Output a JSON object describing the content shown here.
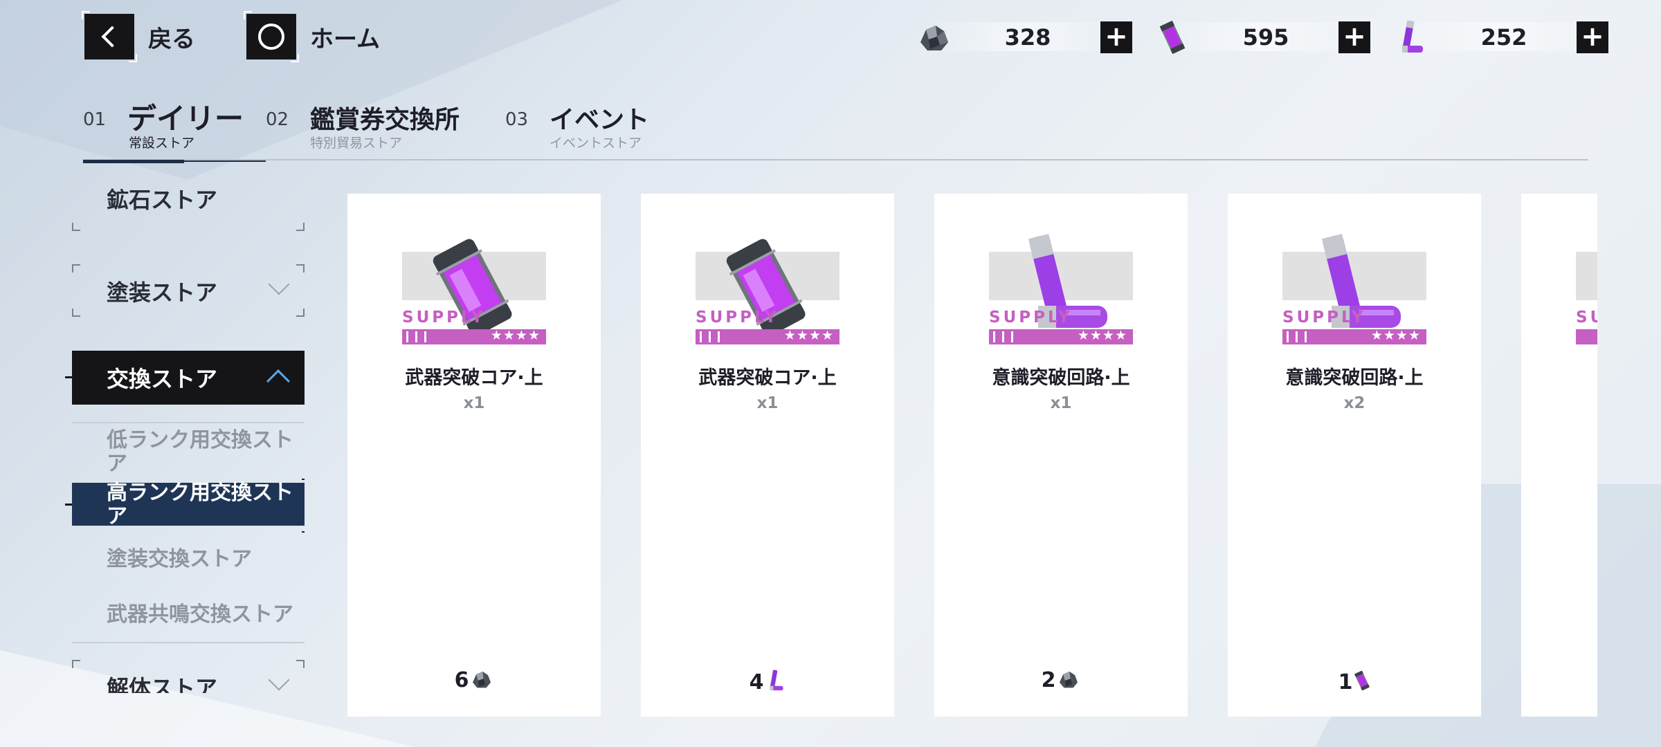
{
  "nav": {
    "back_label": "戻る",
    "home_label": "ホーム"
  },
  "resources": [
    {
      "icon": "ore-icon",
      "value": "328"
    },
    {
      "icon": "weapon-core-icon",
      "value": "595"
    },
    {
      "icon": "circuit-icon",
      "value": "252"
    }
  ],
  "tabs": [
    {
      "num": "01",
      "label": "デイリー",
      "sub": "常設ストア",
      "active": true
    },
    {
      "num": "02",
      "label": "鑑賞券交換所",
      "sub": "特別貿易ストア",
      "active": false
    },
    {
      "num": "03",
      "label": "イベント",
      "sub": "イベントストア",
      "active": false
    }
  ],
  "side": {
    "ore_store": "鉱石ストア",
    "paint_store": "塗装ストア",
    "exchange_store": "交換ストア",
    "sub_items": [
      "低ランク用交換ストア",
      "高ランク用交換ストア",
      "塗装交換ストア",
      "武器共鳴交換ストア"
    ],
    "dismantle_store": "解体ストア"
  },
  "cards": [
    {
      "supply": "SUPPLY",
      "stars": "★★★★",
      "name": "武器突破コア·上",
      "qty": "x1",
      "price": "6",
      "currency": "ore-icon",
      "art": "weapon-core-icon"
    },
    {
      "supply": "SUPPLY",
      "stars": "★★★★",
      "name": "武器突破コア·上",
      "qty": "x1",
      "price": "4",
      "currency": "circuit-icon",
      "art": "weapon-core-icon"
    },
    {
      "supply": "SUPPLY",
      "stars": "★★★★",
      "name": "意識突破回路·上",
      "qty": "x1",
      "price": "2",
      "currency": "ore-icon",
      "art": "circuit-icon"
    },
    {
      "supply": "SUPPLY",
      "stars": "★★★★",
      "name": "意識突破回路·上",
      "qty": "x2",
      "price": "1",
      "currency": "weapon-core-icon",
      "art": "circuit-icon"
    },
    {
      "supply": "SU",
      "stars": "",
      "name": "",
      "qty": "",
      "price": "",
      "currency": "",
      "art": ""
    }
  ],
  "colors": {
    "accent": "#c55fc2",
    "dark": "#151518",
    "selected": "#1f3556",
    "chevron_active": "#5aa7e6"
  }
}
